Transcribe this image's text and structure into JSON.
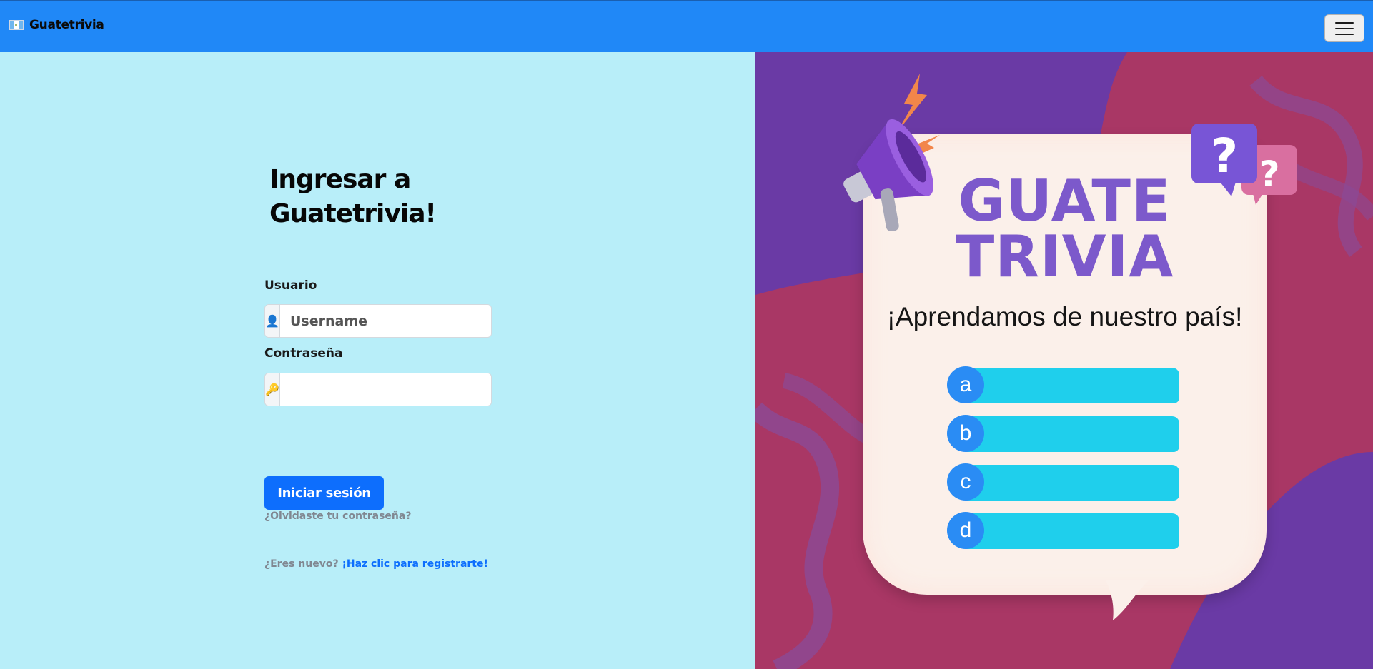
{
  "navbar": {
    "brand": "Guatetrivia",
    "menu_icon": "hamburger-icon"
  },
  "login": {
    "heading": "Ingresar a Guatetrivia!",
    "username_label": "Usuario",
    "username_placeholder": "Username",
    "username_icon": "user-icon",
    "password_label": "Contraseña",
    "password_icon": "key-icon",
    "submit_label": "Iniciar sesión",
    "forgot_link": "¿Olvidaste tu contraseña?",
    "new_user_text": "¿Eres nuevo?",
    "register_link": "¡Haz clic para registrarte!"
  },
  "promo": {
    "title_line1": "GUATE",
    "title_line2": "TRIVIA",
    "subtitle": "¡Aprendamos de nuestro país!",
    "options": [
      "a",
      "b",
      "c",
      "d"
    ]
  },
  "colors": {
    "navbar": "#2088f7",
    "left_bg": "#b8eef9",
    "primary": "#0d6efd",
    "title_purple": "#7c59cb",
    "option_bar": "#1fcfec",
    "option_circle": "#2a8cf4",
    "right_magenta": "#a93765",
    "right_purple": "#6a3aa5"
  }
}
